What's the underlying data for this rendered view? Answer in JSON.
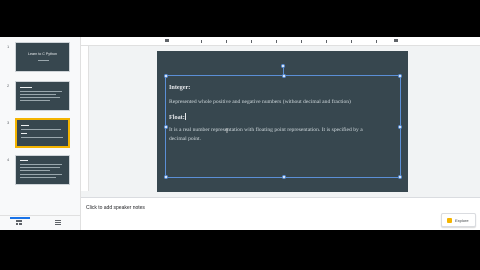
{
  "filmstrip": {
    "slides": [
      {
        "num": "1",
        "title": "Learn to C Python",
        "subtitle": "",
        "selected": false
      },
      {
        "num": "2",
        "title": "",
        "subtitle": "",
        "selected": false
      },
      {
        "num": "3",
        "title": "",
        "subtitle": "",
        "selected": true
      },
      {
        "num": "4",
        "title": "",
        "subtitle": "",
        "selected": false
      }
    ],
    "grid_view_icon": "grid-view-icon",
    "list_view_icon": "list-view-icon"
  },
  "slide": {
    "background": "#37474f",
    "heading1": "Integer:",
    "body1": "Represented whole positive and negative numbers (without decimal and fraction)",
    "heading2": "Float:",
    "body2_line1": "It is a real number representation with floating point representation. It is specified by a",
    "body2_line2": "decimal point."
  },
  "notes": {
    "placeholder": "Click to add speaker notes"
  },
  "explore": {
    "label": "Explore",
    "icon": "explore-icon",
    "accent": "#f4b400"
  },
  "colors": {
    "selection": "#5b8fd6",
    "selected_thumb_border": "#f4b400"
  }
}
